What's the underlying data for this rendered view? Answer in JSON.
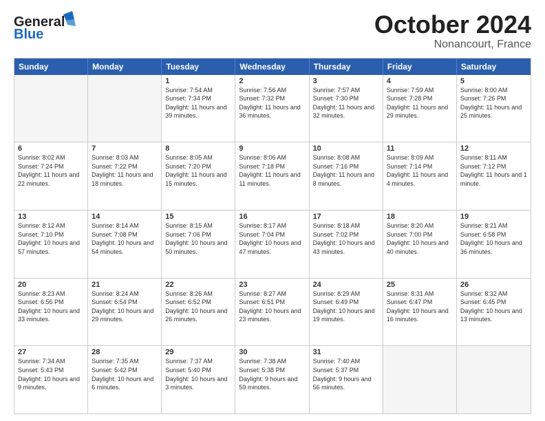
{
  "header": {
    "logo_general": "General",
    "logo_blue": "Blue",
    "month_title": "October 2024",
    "location": "Nonancourt, France"
  },
  "days_of_week": [
    "Sunday",
    "Monday",
    "Tuesday",
    "Wednesday",
    "Thursday",
    "Friday",
    "Saturday"
  ],
  "weeks": [
    [
      {
        "day": "",
        "empty": true
      },
      {
        "day": "",
        "empty": true
      },
      {
        "day": "1",
        "sunrise": "Sunrise: 7:54 AM",
        "sunset": "Sunset: 7:34 PM",
        "daylight": "Daylight: 11 hours and 39 minutes."
      },
      {
        "day": "2",
        "sunrise": "Sunrise: 7:56 AM",
        "sunset": "Sunset: 7:32 PM",
        "daylight": "Daylight: 11 hours and 36 minutes."
      },
      {
        "day": "3",
        "sunrise": "Sunrise: 7:57 AM",
        "sunset": "Sunset: 7:30 PM",
        "daylight": "Daylight: 11 hours and 32 minutes."
      },
      {
        "day": "4",
        "sunrise": "Sunrise: 7:59 AM",
        "sunset": "Sunset: 7:28 PM",
        "daylight": "Daylight: 11 hours and 29 minutes."
      },
      {
        "day": "5",
        "sunrise": "Sunrise: 8:00 AM",
        "sunset": "Sunset: 7:26 PM",
        "daylight": "Daylight: 11 hours and 25 minutes."
      }
    ],
    [
      {
        "day": "6",
        "sunrise": "Sunrise: 8:02 AM",
        "sunset": "Sunset: 7:24 PM",
        "daylight": "Daylight: 11 hours and 22 minutes."
      },
      {
        "day": "7",
        "sunrise": "Sunrise: 8:03 AM",
        "sunset": "Sunset: 7:22 PM",
        "daylight": "Daylight: 11 hours and 18 minutes."
      },
      {
        "day": "8",
        "sunrise": "Sunrise: 8:05 AM",
        "sunset": "Sunset: 7:20 PM",
        "daylight": "Daylight: 11 hours and 15 minutes."
      },
      {
        "day": "9",
        "sunrise": "Sunrise: 8:06 AM",
        "sunset": "Sunset: 7:18 PM",
        "daylight": "Daylight: 11 hours and 11 minutes."
      },
      {
        "day": "10",
        "sunrise": "Sunrise: 8:08 AM",
        "sunset": "Sunset: 7:16 PM",
        "daylight": "Daylight: 11 hours and 8 minutes."
      },
      {
        "day": "11",
        "sunrise": "Sunrise: 8:09 AM",
        "sunset": "Sunset: 7:14 PM",
        "daylight": "Daylight: 11 hours and 4 minutes."
      },
      {
        "day": "12",
        "sunrise": "Sunrise: 8:11 AM",
        "sunset": "Sunset: 7:12 PM",
        "daylight": "Daylight: 11 hours and 1 minute."
      }
    ],
    [
      {
        "day": "13",
        "sunrise": "Sunrise: 8:12 AM",
        "sunset": "Sunset: 7:10 PM",
        "daylight": "Daylight: 10 hours and 57 minutes."
      },
      {
        "day": "14",
        "sunrise": "Sunrise: 8:14 AM",
        "sunset": "Sunset: 7:08 PM",
        "daylight": "Daylight: 10 hours and 54 minutes."
      },
      {
        "day": "15",
        "sunrise": "Sunrise: 8:15 AM",
        "sunset": "Sunset: 7:06 PM",
        "daylight": "Daylight: 10 hours and 50 minutes."
      },
      {
        "day": "16",
        "sunrise": "Sunrise: 8:17 AM",
        "sunset": "Sunset: 7:04 PM",
        "daylight": "Daylight: 10 hours and 47 minutes."
      },
      {
        "day": "17",
        "sunrise": "Sunrise: 8:18 AM",
        "sunset": "Sunset: 7:02 PM",
        "daylight": "Daylight: 10 hours and 43 minutes."
      },
      {
        "day": "18",
        "sunrise": "Sunrise: 8:20 AM",
        "sunset": "Sunset: 7:00 PM",
        "daylight": "Daylight: 10 hours and 40 minutes."
      },
      {
        "day": "19",
        "sunrise": "Sunrise: 8:21 AM",
        "sunset": "Sunset: 6:58 PM",
        "daylight": "Daylight: 10 hours and 36 minutes."
      }
    ],
    [
      {
        "day": "20",
        "sunrise": "Sunrise: 8:23 AM",
        "sunset": "Sunset: 6:56 PM",
        "daylight": "Daylight: 10 hours and 33 minutes."
      },
      {
        "day": "21",
        "sunrise": "Sunrise: 8:24 AM",
        "sunset": "Sunset: 6:54 PM",
        "daylight": "Daylight: 10 hours and 29 minutes."
      },
      {
        "day": "22",
        "sunrise": "Sunrise: 8:26 AM",
        "sunset": "Sunset: 6:52 PM",
        "daylight": "Daylight: 10 hours and 26 minutes."
      },
      {
        "day": "23",
        "sunrise": "Sunrise: 8:27 AM",
        "sunset": "Sunset: 6:51 PM",
        "daylight": "Daylight: 10 hours and 23 minutes."
      },
      {
        "day": "24",
        "sunrise": "Sunrise: 8:29 AM",
        "sunset": "Sunset: 6:49 PM",
        "daylight": "Daylight: 10 hours and 19 minutes."
      },
      {
        "day": "25",
        "sunrise": "Sunrise: 8:31 AM",
        "sunset": "Sunset: 6:47 PM",
        "daylight": "Daylight: 10 hours and 16 minutes."
      },
      {
        "day": "26",
        "sunrise": "Sunrise: 8:32 AM",
        "sunset": "Sunset: 6:45 PM",
        "daylight": "Daylight: 10 hours and 13 minutes."
      }
    ],
    [
      {
        "day": "27",
        "sunrise": "Sunrise: 7:34 AM",
        "sunset": "Sunset: 5:43 PM",
        "daylight": "Daylight: 10 hours and 9 minutes."
      },
      {
        "day": "28",
        "sunrise": "Sunrise: 7:35 AM",
        "sunset": "Sunset: 5:42 PM",
        "daylight": "Daylight: 10 hours and 6 minutes."
      },
      {
        "day": "29",
        "sunrise": "Sunrise: 7:37 AM",
        "sunset": "Sunset: 5:40 PM",
        "daylight": "Daylight: 10 hours and 3 minutes."
      },
      {
        "day": "30",
        "sunrise": "Sunrise: 7:38 AM",
        "sunset": "Sunset: 5:38 PM",
        "daylight": "Daylight: 9 hours and 59 minutes."
      },
      {
        "day": "31",
        "sunrise": "Sunrise: 7:40 AM",
        "sunset": "Sunset: 5:37 PM",
        "daylight": "Daylight: 9 hours and 56 minutes."
      },
      {
        "day": "",
        "empty": true
      },
      {
        "day": "",
        "empty": true
      }
    ]
  ]
}
